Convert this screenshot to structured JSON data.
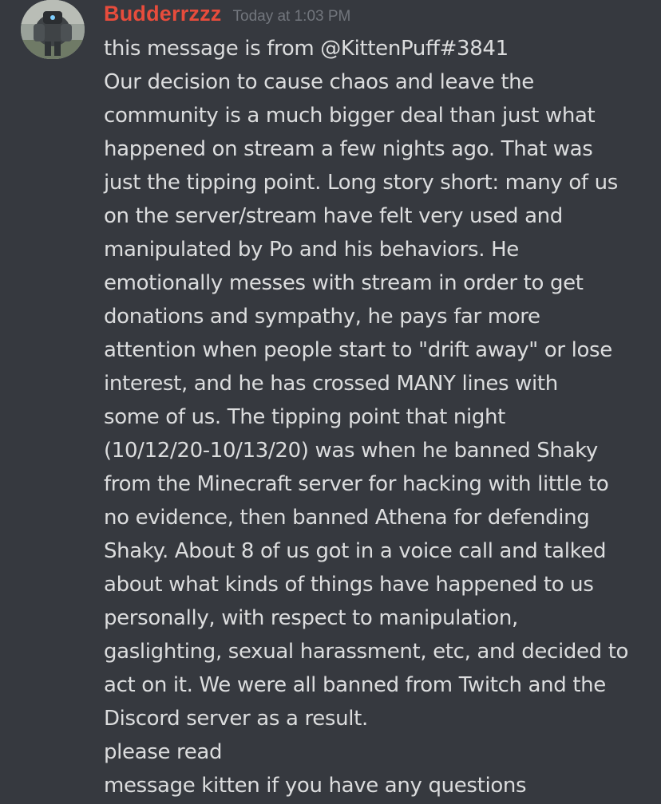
{
  "message": {
    "author": "Budderrzzz",
    "timestamp": "Today at 1:03 PM",
    "lines": [
      "this message is from @KittenPuff#3841",
      "Our decision to cause chaos and leave the",
      "community is a much bigger deal than just what",
      "happened on stream a few nights ago. That was",
      "just the tipping point. Long story short: many of us",
      "on the server/stream have felt very used and",
      "manipulated by Po and his behaviors. He",
      "emotionally messes with stream in order to get",
      "donations and sympathy, he pays far more",
      "attention when people start to \"drift away\" or lose",
      "interest, and he has crossed MANY lines with",
      "some of us. The tipping point that night",
      "(10/12/20-10/13/20) was when he banned Shaky",
      "from the Minecraft server for hacking with little to",
      "no evidence, then banned Athena for defending",
      "Shaky. About 8 of us got in a voice call and talked",
      "about what kinds of things have happened to us",
      "personally, with respect to manipulation,",
      "gaslighting, sexual harassment, etc, and decided to",
      "act on it. We were all banned from Twitch and the",
      "Discord server as a result.",
      "please read",
      "message kitten if you have any questions"
    ]
  },
  "colors": {
    "background": "#36393f",
    "username": "#e74c3c",
    "timestamp": "#72767d",
    "text": "#dcddde"
  }
}
